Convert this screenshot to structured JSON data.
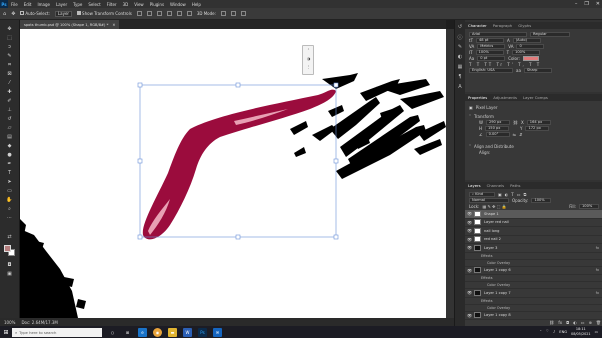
{
  "app": {
    "logo": "Ps",
    "menu": [
      "File",
      "Edit",
      "Image",
      "Layer",
      "Type",
      "Select",
      "Filter",
      "3D",
      "View",
      "Plugins",
      "Window",
      "Help"
    ],
    "window_controls": [
      "–",
      "❐",
      "✕"
    ]
  },
  "options_bar": {
    "auto_select_label": "Auto-Select:",
    "auto_select_value": "Layer",
    "show_transform_label": "Show Transform Controls",
    "mode_3d_label": "3D Mode:"
  },
  "document_tab": {
    "title": "spots thumb.psd @ 100% (Shape 1, RGB/8#) *",
    "close": "✕"
  },
  "status": {
    "zoom": "100%",
    "doc_size": "Doc: 2.64M/17.3M"
  },
  "properties_panel": {
    "tabs": [
      "Properties",
      "Adjustments",
      "Layer Comps"
    ],
    "layer_kind": "Pixel Layer",
    "transform_label": "Transform",
    "w_value": "290 px",
    "x_value": "164 px",
    "h_value": "150 px",
    "y_value": "172 px",
    "angle_value": "0.00°",
    "align_label": "Align and Distribute",
    "align_sub": "Align:"
  },
  "character_panel": {
    "tabs": [
      "Character",
      "Paragraph",
      "Glyphs"
    ],
    "font_family": "Arial",
    "font_style": "Regular",
    "font_size": "48 pt",
    "leading": "(Auto)",
    "kerning": "Metrics",
    "tracking": "0",
    "vscale": "100%",
    "hscale": "100%",
    "baseline": "0 pt",
    "color_label": "Color:",
    "language": "English: USA",
    "antialias": "Sharp",
    "text_color": "#e07b7b"
  },
  "layers_panel": {
    "tabs": [
      "Layers",
      "Channels",
      "Paths"
    ],
    "filter_kind": "Kind",
    "blend_mode": "Normal",
    "opacity_label": "Opacity:",
    "opacity_value": "100%",
    "lock_label": "Lock:",
    "fill_label": "Fill:",
    "fill_value": "100%",
    "layers": [
      {
        "name": "Shape 1",
        "selected": true,
        "dark": false,
        "fx": false
      },
      {
        "name": "Layer red nail",
        "selected": false,
        "dark": false,
        "fx": false
      },
      {
        "name": "nail long",
        "selected": false,
        "dark": false,
        "fx": false
      },
      {
        "name": "red nail 2",
        "selected": false,
        "dark": false,
        "fx": false
      },
      {
        "name": "Layer 3",
        "selected": false,
        "dark": true,
        "fx": true
      },
      {
        "name": "Layer 1 copy 6",
        "selected": false,
        "dark": true,
        "fx": true
      },
      {
        "name": "Layer 1 copy 7",
        "selected": false,
        "dark": true,
        "fx": true
      },
      {
        "name": "Layer 1 copy 8",
        "selected": false,
        "dark": true,
        "fx": false
      }
    ],
    "effects_label": "Effects",
    "color_overlay_label": "Color Overlay",
    "fx_label": "fx"
  },
  "taskbar": {
    "search_placeholder": "Type here to search",
    "apps": [
      "○",
      "⊞",
      "e",
      "◉",
      "▬",
      "W",
      "Ps",
      "✉"
    ],
    "tray": "ENG",
    "time": "18:11",
    "date": "08/05/2021"
  },
  "colors": {
    "nail_fill": "#9b0c3d",
    "nail_highlight": "#e8a0b4",
    "foreground_swatch": "#b47d7d",
    "ui_accent": "#31a8ff"
  }
}
